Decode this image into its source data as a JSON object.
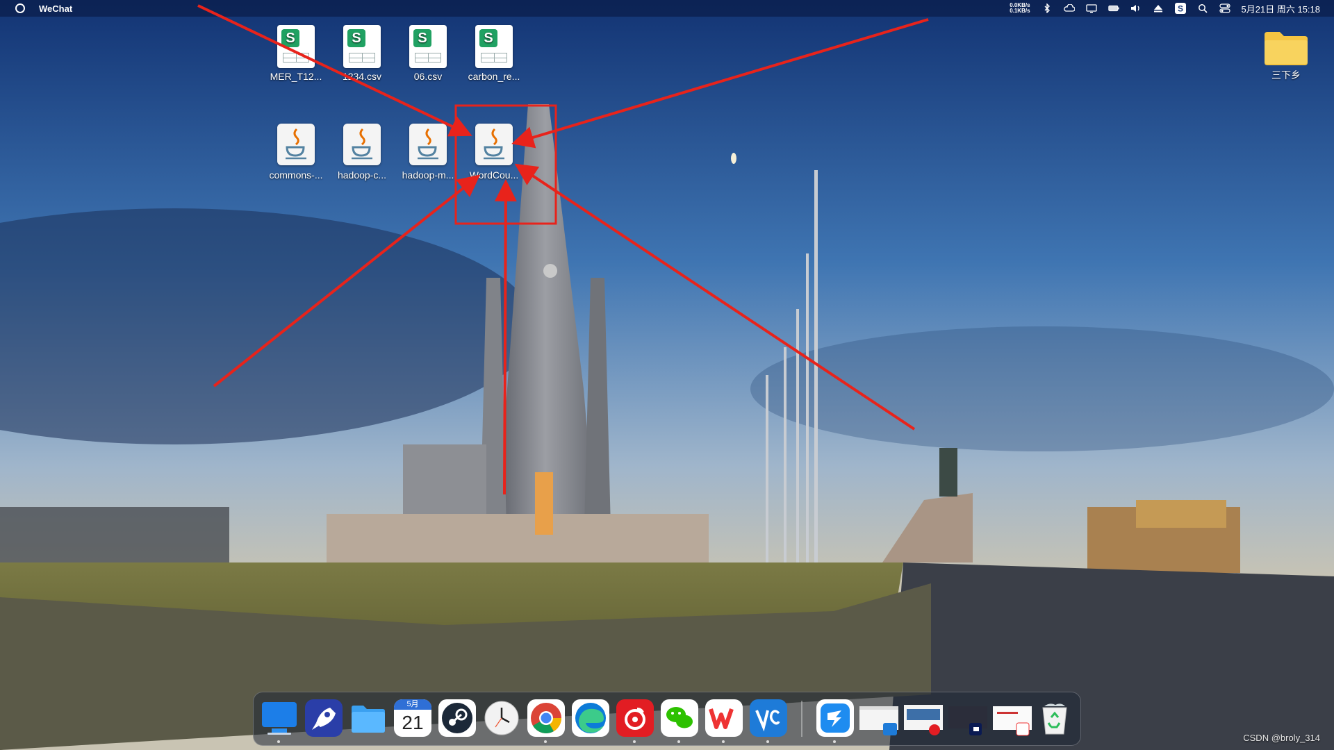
{
  "menubar": {
    "app_name": "WeChat",
    "net_down": "0.0KB/s",
    "net_up": "0.1KB/s",
    "datetime": "5月21日 周六 15:18"
  },
  "desktop": {
    "icons": [
      {
        "label": "MER_T12...",
        "type": "spreadsheet"
      },
      {
        "label": "1234.csv",
        "type": "spreadsheet"
      },
      {
        "label": "06.csv",
        "type": "spreadsheet"
      },
      {
        "label": "carbon_re...",
        "type": "spreadsheet"
      },
      {
        "label": "commons-...",
        "type": "java-archive"
      },
      {
        "label": "hadoop-c...",
        "type": "java-archive"
      },
      {
        "label": "hadoop-m...",
        "type": "java-archive"
      },
      {
        "label": "WordCou...",
        "type": "java-archive"
      },
      {
        "label": "三下乡",
        "type": "folder"
      }
    ]
  },
  "dock": {
    "items": [
      {
        "name": "Finder"
      },
      {
        "name": "Launchpad"
      },
      {
        "name": "Files"
      },
      {
        "name": "Calendar",
        "month": "5月",
        "day": "21"
      },
      {
        "name": "Steam"
      },
      {
        "name": "Clock"
      },
      {
        "name": "Chrome"
      },
      {
        "name": "Edge"
      },
      {
        "name": "NetEase Cloud Music"
      },
      {
        "name": "WeChat"
      },
      {
        "name": "WPS Office"
      },
      {
        "name": "VS Code"
      },
      {
        "name": "DingTalk"
      },
      {
        "name": "Window preview 1"
      },
      {
        "name": "Window preview 2"
      },
      {
        "name": "Window preview 3"
      },
      {
        "name": "Window preview 4"
      },
      {
        "name": "Recycle Bin"
      }
    ]
  },
  "colors": {
    "accent_red": "#e8231b",
    "sheet_green": "#20a162",
    "folder_yellow": "#f5c542"
  },
  "watermark": "CSDN @broly_314"
}
